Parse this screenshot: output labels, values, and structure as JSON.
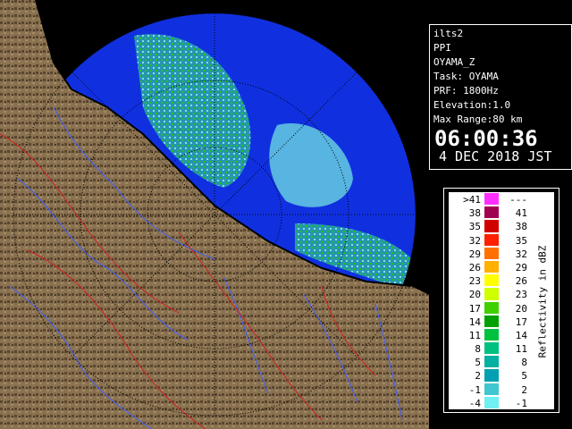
{
  "info": {
    "lines": [
      "ilts2",
      "PPI",
      "OYAMA_Z",
      "Task: OYAMA",
      "PRF: 1800Hz",
      "Elevation:1.0",
      "Max Range:80 km"
    ],
    "time": "06:00:36",
    "date": "4 DEC 2018 JST"
  },
  "legend": {
    "title": "Reflectivity in dBZ",
    "rows": [
      {
        "lo": ">41",
        "hi": "---",
        "color": "#ff30ff"
      },
      {
        "lo": "38",
        "hi": "41",
        "color": "#a00050"
      },
      {
        "lo": "35",
        "hi": "38",
        "color": "#d00000"
      },
      {
        "lo": "32",
        "hi": "35",
        "color": "#ff2000"
      },
      {
        "lo": "29",
        "hi": "32",
        "color": "#ff7000"
      },
      {
        "lo": "26",
        "hi": "29",
        "color": "#ffb000"
      },
      {
        "lo": "23",
        "hi": "26",
        "color": "#ffff00"
      },
      {
        "lo": "20",
        "hi": "23",
        "color": "#d0ff00"
      },
      {
        "lo": "17",
        "hi": "20",
        "color": "#40d000"
      },
      {
        "lo": "14",
        "hi": "17",
        "color": "#00a000"
      },
      {
        "lo": "11",
        "hi": "14",
        "color": "#00c040"
      },
      {
        "lo": "8",
        "hi": "11",
        "color": "#00c080"
      },
      {
        "lo": "5",
        "hi": "8",
        "color": "#00b0a0"
      },
      {
        "lo": "2",
        "hi": "5",
        "color": "#00a0b0"
      },
      {
        "lo": "-1",
        "hi": "2",
        "color": "#40c8d0"
      },
      {
        "lo": "-4",
        "hi": "-1",
        "color": "#70f0f0"
      }
    ]
  },
  "colors": {
    "sea": "#1030e0",
    "land": "#8a7250",
    "land_dark": "#4a3a28",
    "rivers": "#4060ff",
    "borders": "#d02020",
    "range_rings": "#000000"
  }
}
